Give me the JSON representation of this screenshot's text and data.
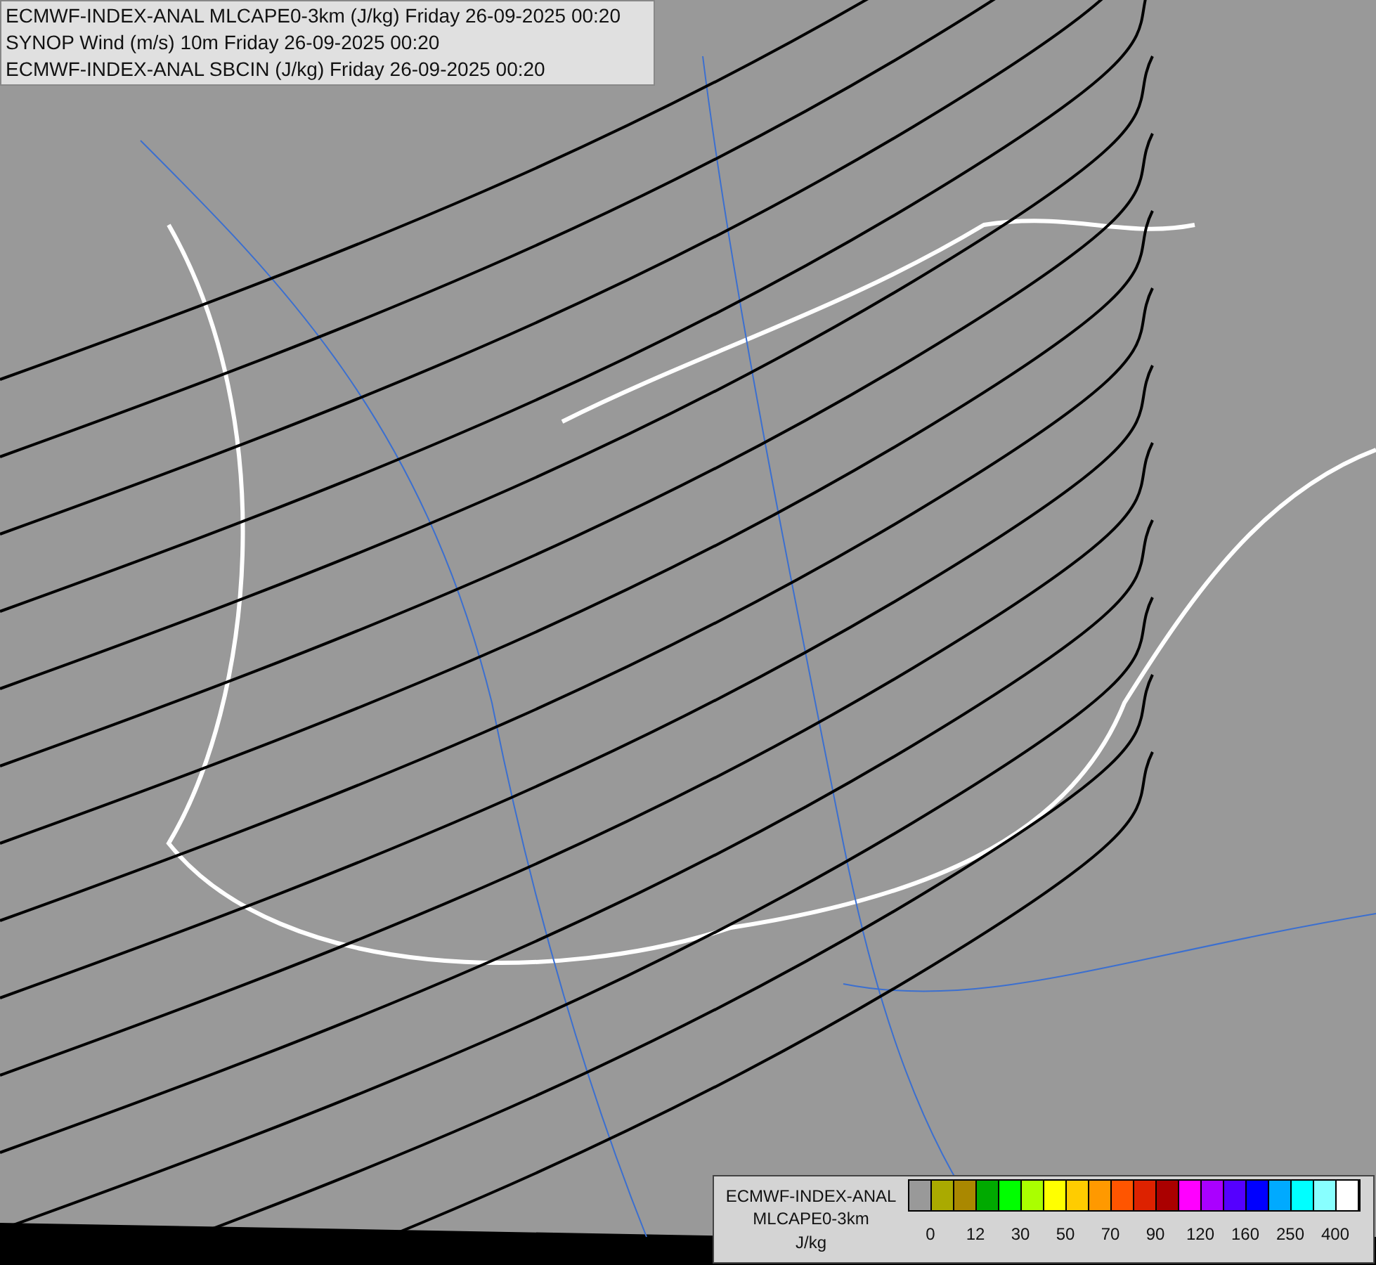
{
  "header_legend": [
    "ECMWF-INDEX-ANAL MLCAPE0-3km (J/kg) Friday 26-09-2025 00:20",
    "SYNOP Wind (m/s) 10m Friday 26-09-2025 00:20",
    "ECMWF-INDEX-ANAL SBCIN (J/kg) Friday 26-09-2025 00:20"
  ],
  "color_scale": {
    "title": "ECMWF-INDEX-ANAL",
    "subtitle": "MLCAPE0-3km",
    "unit": "J/kg",
    "swatches": [
      {
        "color": "#999999"
      },
      {
        "color": "#aaaa00"
      },
      {
        "color": "#aa8800"
      },
      {
        "color": "#00aa00"
      },
      {
        "color": "#00ff00"
      },
      {
        "color": "#aaff00"
      },
      {
        "color": "#ffff00"
      },
      {
        "color": "#ffcc00"
      },
      {
        "color": "#ff9900"
      },
      {
        "color": "#ff5500"
      },
      {
        "color": "#dd2200"
      },
      {
        "color": "#aa0000"
      },
      {
        "color": "#ff00ff"
      },
      {
        "color": "#aa00ff"
      },
      {
        "color": "#5500ff"
      },
      {
        "color": "#0000ff"
      },
      {
        "color": "#00aaff"
      },
      {
        "color": "#00ffff"
      },
      {
        "color": "#88ffff"
      },
      {
        "color": "#ffffff"
      }
    ],
    "tick_labels": [
      "0",
      "12",
      "30",
      "50",
      "70",
      "90",
      "120",
      "160",
      "250",
      "400"
    ]
  }
}
